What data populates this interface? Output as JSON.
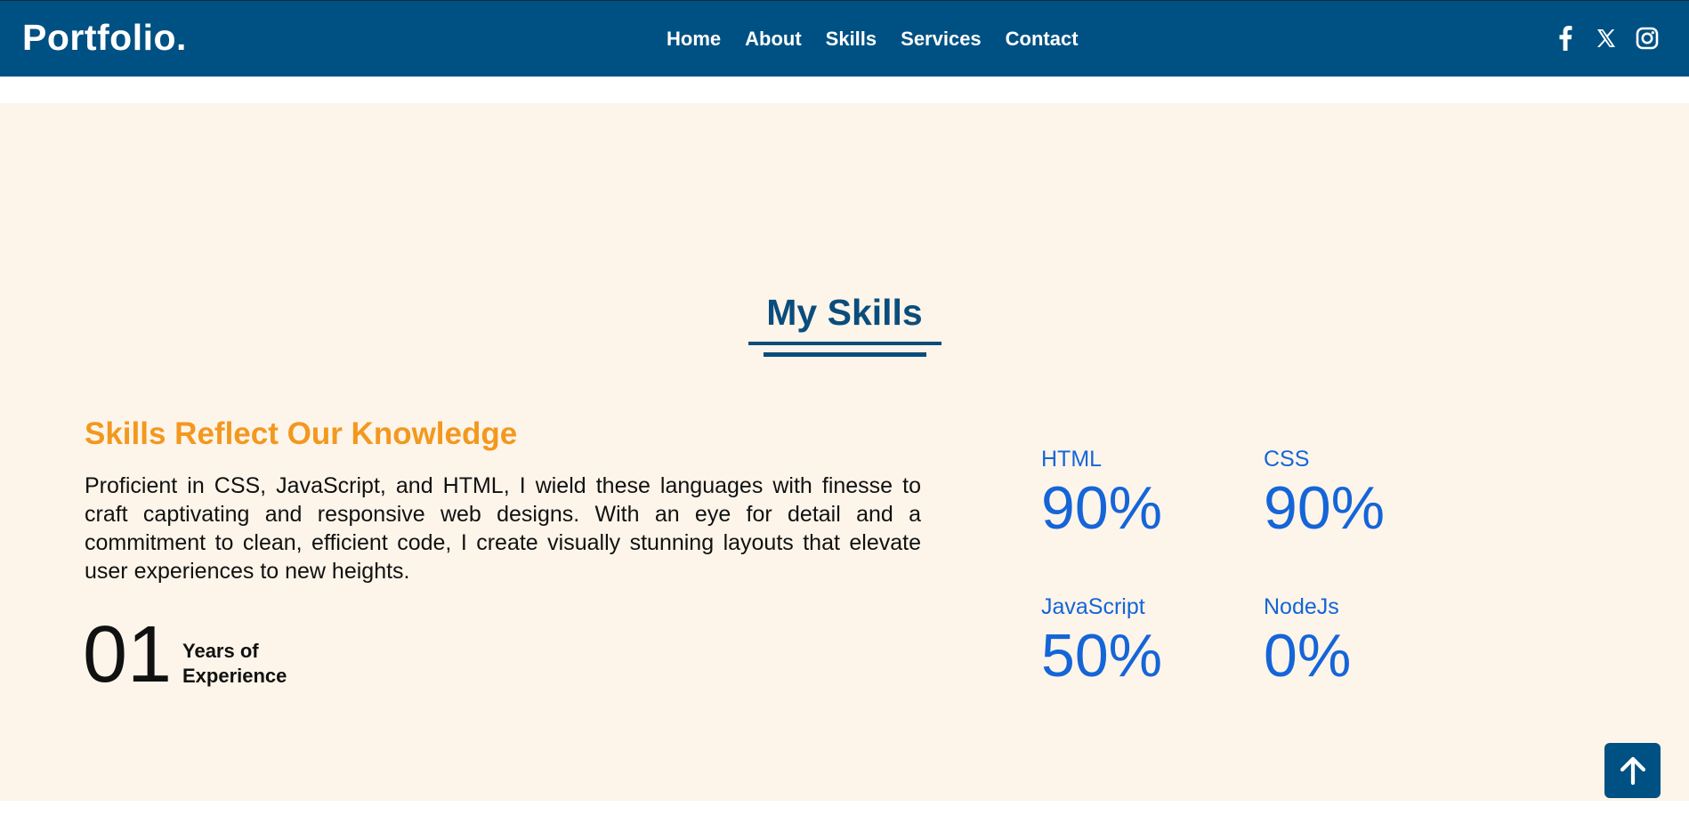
{
  "navbar": {
    "logo": "Portfolio.",
    "links": [
      "Home",
      "About",
      "Skills",
      "Services",
      "Contact"
    ],
    "socials": [
      "facebook-icon",
      "x-icon",
      "instagram-icon"
    ]
  },
  "skills_section": {
    "title": "My Skills",
    "subheading": "Skills Reflect Our Knowledge",
    "description": "Proficient in CSS, JavaScript, and HTML, I wield these languages with finesse to craft captivating and responsive web designs. With an eye for detail and a commitment to clean, efficient code, I create visually stunning layouts that elevate user experiences to new heights.",
    "years_number": "01",
    "years_label_line1": "Years of",
    "years_label_line2": "Experience",
    "skills": [
      {
        "name": "HTML",
        "percent": "90%"
      },
      {
        "name": "CSS",
        "percent": "90%"
      },
      {
        "name": "JavaScript",
        "percent": "50%"
      },
      {
        "name": "NodeJs",
        "percent": "0%"
      }
    ]
  },
  "scroll_top": {
    "icon": "arrow-up-icon"
  },
  "colors": {
    "navbar_bg": "#005183",
    "section_bg": "#fdf5ea",
    "title": "#0a4d7c",
    "subheading": "#f3981f",
    "skill_text": "#1565d8"
  }
}
